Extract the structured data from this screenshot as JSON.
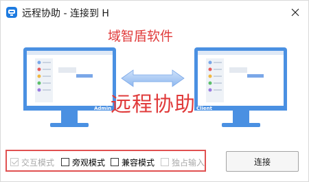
{
  "window": {
    "title": "远程协助 - 连接到 H"
  },
  "illustration": {
    "watermark_top": "域智盾软件",
    "watermark_center": "远程协助",
    "left_monitor_label": "Admin",
    "right_monitor_label": "Client"
  },
  "options": [
    {
      "label": "交互模式",
      "checked": true,
      "disabled": true
    },
    {
      "label": "旁观模式",
      "checked": false,
      "disabled": false
    },
    {
      "label": "兼容模式",
      "checked": false,
      "disabled": false
    },
    {
      "label": "独占输入",
      "checked": false,
      "disabled": true
    }
  ],
  "buttons": {
    "connect": "连接"
  },
  "colors": {
    "accent": "#1e7be0",
    "monitor": "#4a90e2",
    "watermark": "#e03b3b",
    "highlight_border": "#e05050"
  }
}
